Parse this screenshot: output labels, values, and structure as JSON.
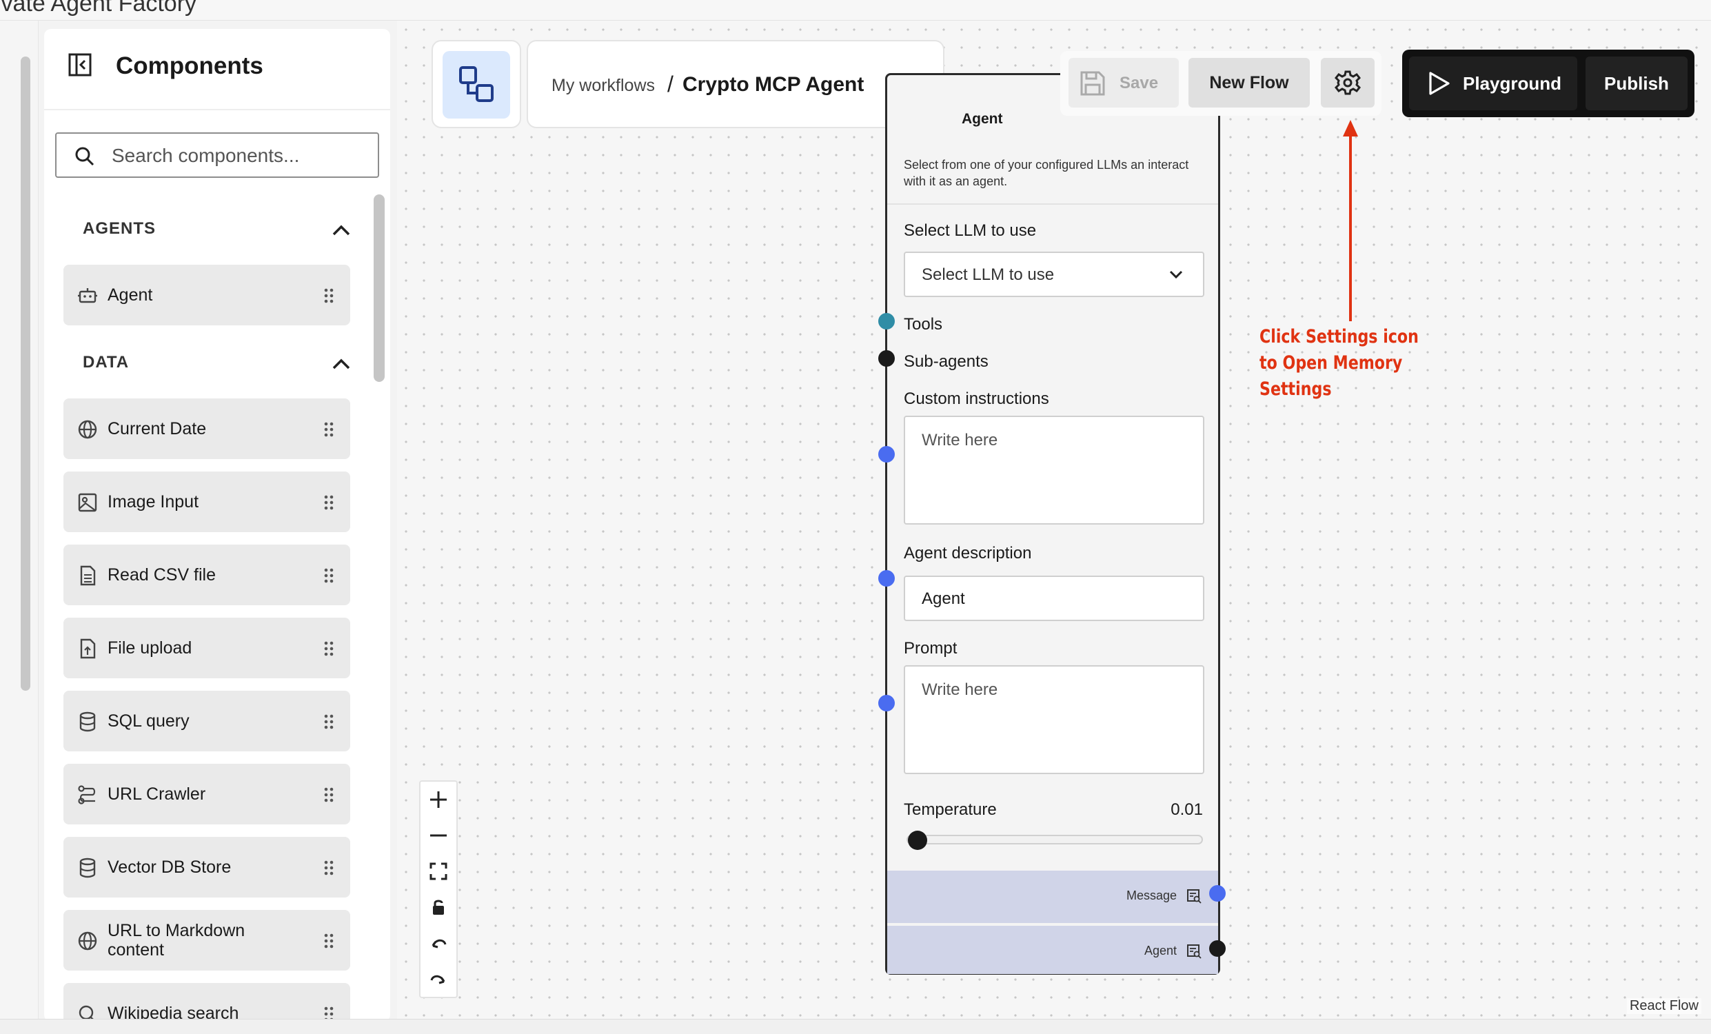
{
  "window": {
    "app_title": "ivate Agent Factory",
    "top_right_text": ""
  },
  "sidebar": {
    "title": "Components",
    "search_placeholder": "Search components...",
    "sections": [
      {
        "label": "AGENTS",
        "items": [
          {
            "label": "Agent",
            "icon": "robot-icon"
          }
        ]
      },
      {
        "label": "DATA",
        "items": [
          {
            "label": "Current Date",
            "icon": "globe-icon"
          },
          {
            "label": "Image Input",
            "icon": "image-icon"
          },
          {
            "label": "Read CSV file",
            "icon": "csv-file-icon"
          },
          {
            "label": "File upload",
            "icon": "file-upload-icon"
          },
          {
            "label": "SQL query",
            "icon": "database-icon"
          },
          {
            "label": "URL Crawler",
            "icon": "crawler-icon"
          },
          {
            "label": "Vector DB Store",
            "icon": "database-icon"
          },
          {
            "label": "URL to Markdown content",
            "icon": "globe-icon"
          },
          {
            "label": "Wikipedia search",
            "icon": "search-icon"
          }
        ]
      }
    ]
  },
  "header": {
    "breadcrumb_root": "My workflows",
    "breadcrumb_separator": "/",
    "flow_name": "Crypto MCP Agent",
    "save_label": "Save",
    "new_flow_label": "New Flow",
    "playground_label": "Playground",
    "publish_label": "Publish"
  },
  "node": {
    "title": "Agent",
    "description": "Select from one of your configured LLMs an interact with it as an agent.",
    "llm_label": "Select LLM to use",
    "llm_value": "Select LLM to use",
    "tools_label": "Tools",
    "subagents_label": "Sub-agents",
    "custom_instructions_label": "Custom instructions",
    "custom_instructions_placeholder": "Write here",
    "agent_description_label": "Agent description",
    "agent_description_value": "Agent",
    "prompt_label": "Prompt",
    "prompt_placeholder": "Write here",
    "temperature_label": "Temperature",
    "temperature_value": "0.01",
    "outputs": [
      {
        "label": "Message"
      },
      {
        "label": "Agent"
      }
    ]
  },
  "annotation": {
    "text": "Click Settings icon to Open Memory Settings",
    "color": "#e03312"
  },
  "canvas": {
    "attribution": "React Flow",
    "controls": [
      "zoom-in-icon",
      "zoom-out-icon",
      "fit-view-icon",
      "lock-icon",
      "undo-icon",
      "redo-icon"
    ]
  },
  "colors": {
    "port_tools": "#2f8da6",
    "port_input": "#4a6cf0",
    "port_dark": "#1a1a1a",
    "output_bg": "#d0d4e8",
    "logo_bg": "#dbe9fd"
  }
}
